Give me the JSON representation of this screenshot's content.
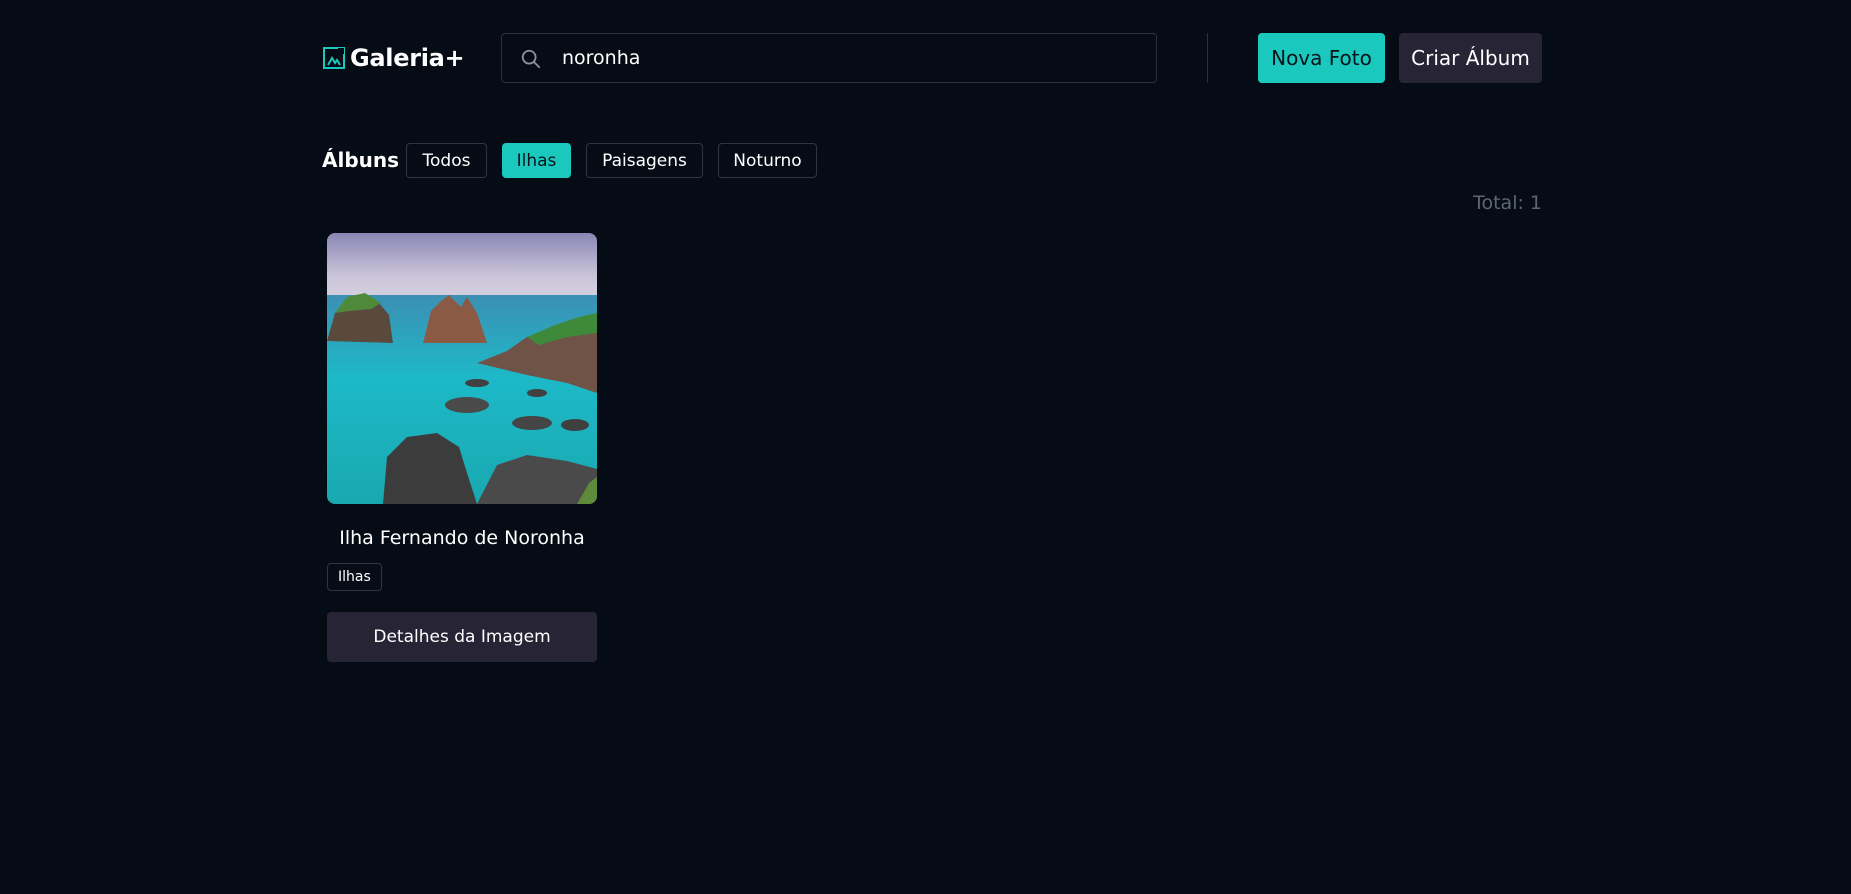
{
  "header": {
    "logo_text": "Galeria+",
    "search": {
      "value": "noronha",
      "placeholder": ""
    },
    "new_photo_label": "Nova Foto",
    "create_album_label": "Criar Álbum"
  },
  "filters": {
    "label": "Álbuns",
    "chips": [
      "Todos",
      "Ilhas",
      "Paisagens",
      "Noturno"
    ],
    "active": "Ilhas"
  },
  "total_label": "Total: 1",
  "cards": [
    {
      "title": "Ilha Fernando de Noronha",
      "tag": "Ilhas",
      "details_label": "Detalhes da Imagem"
    }
  ],
  "colors": {
    "background": "#050c16",
    "accent": "#1ac8bd",
    "secondary_button": "#262435",
    "muted_text": "#5f6670",
    "border": "#2f3640"
  },
  "icons": {
    "logo": "image-frame-icon",
    "search": "search-icon"
  }
}
